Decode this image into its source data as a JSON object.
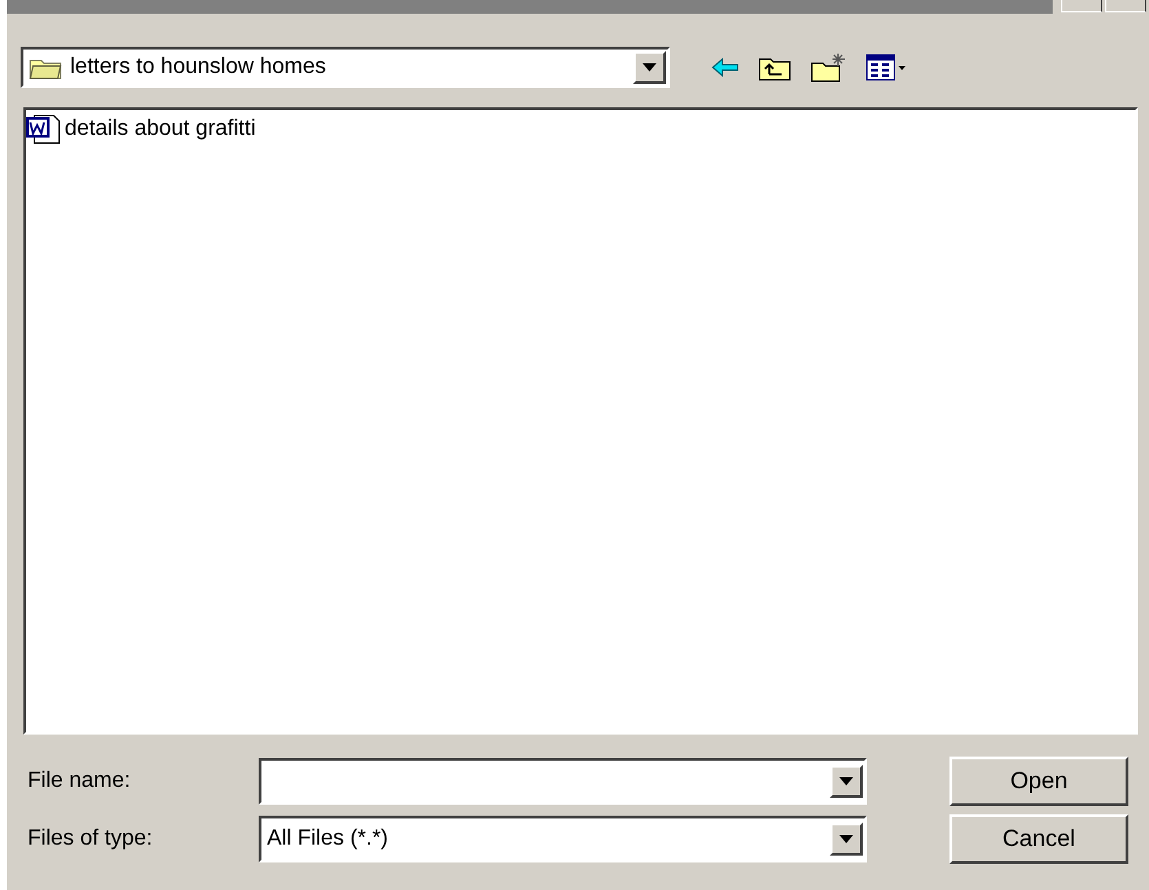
{
  "look_in": {
    "value": "letters to hounslow homes"
  },
  "files": [
    {
      "name": "details about grafitti",
      "selected": false
    }
  ],
  "file_name": {
    "label": "File name:"
  },
  "file_type": {
    "label": "Files of type:",
    "value": "All Files (*.*)"
  },
  "buttons": [
    "Open",
    "Cancel"
  ]
}
